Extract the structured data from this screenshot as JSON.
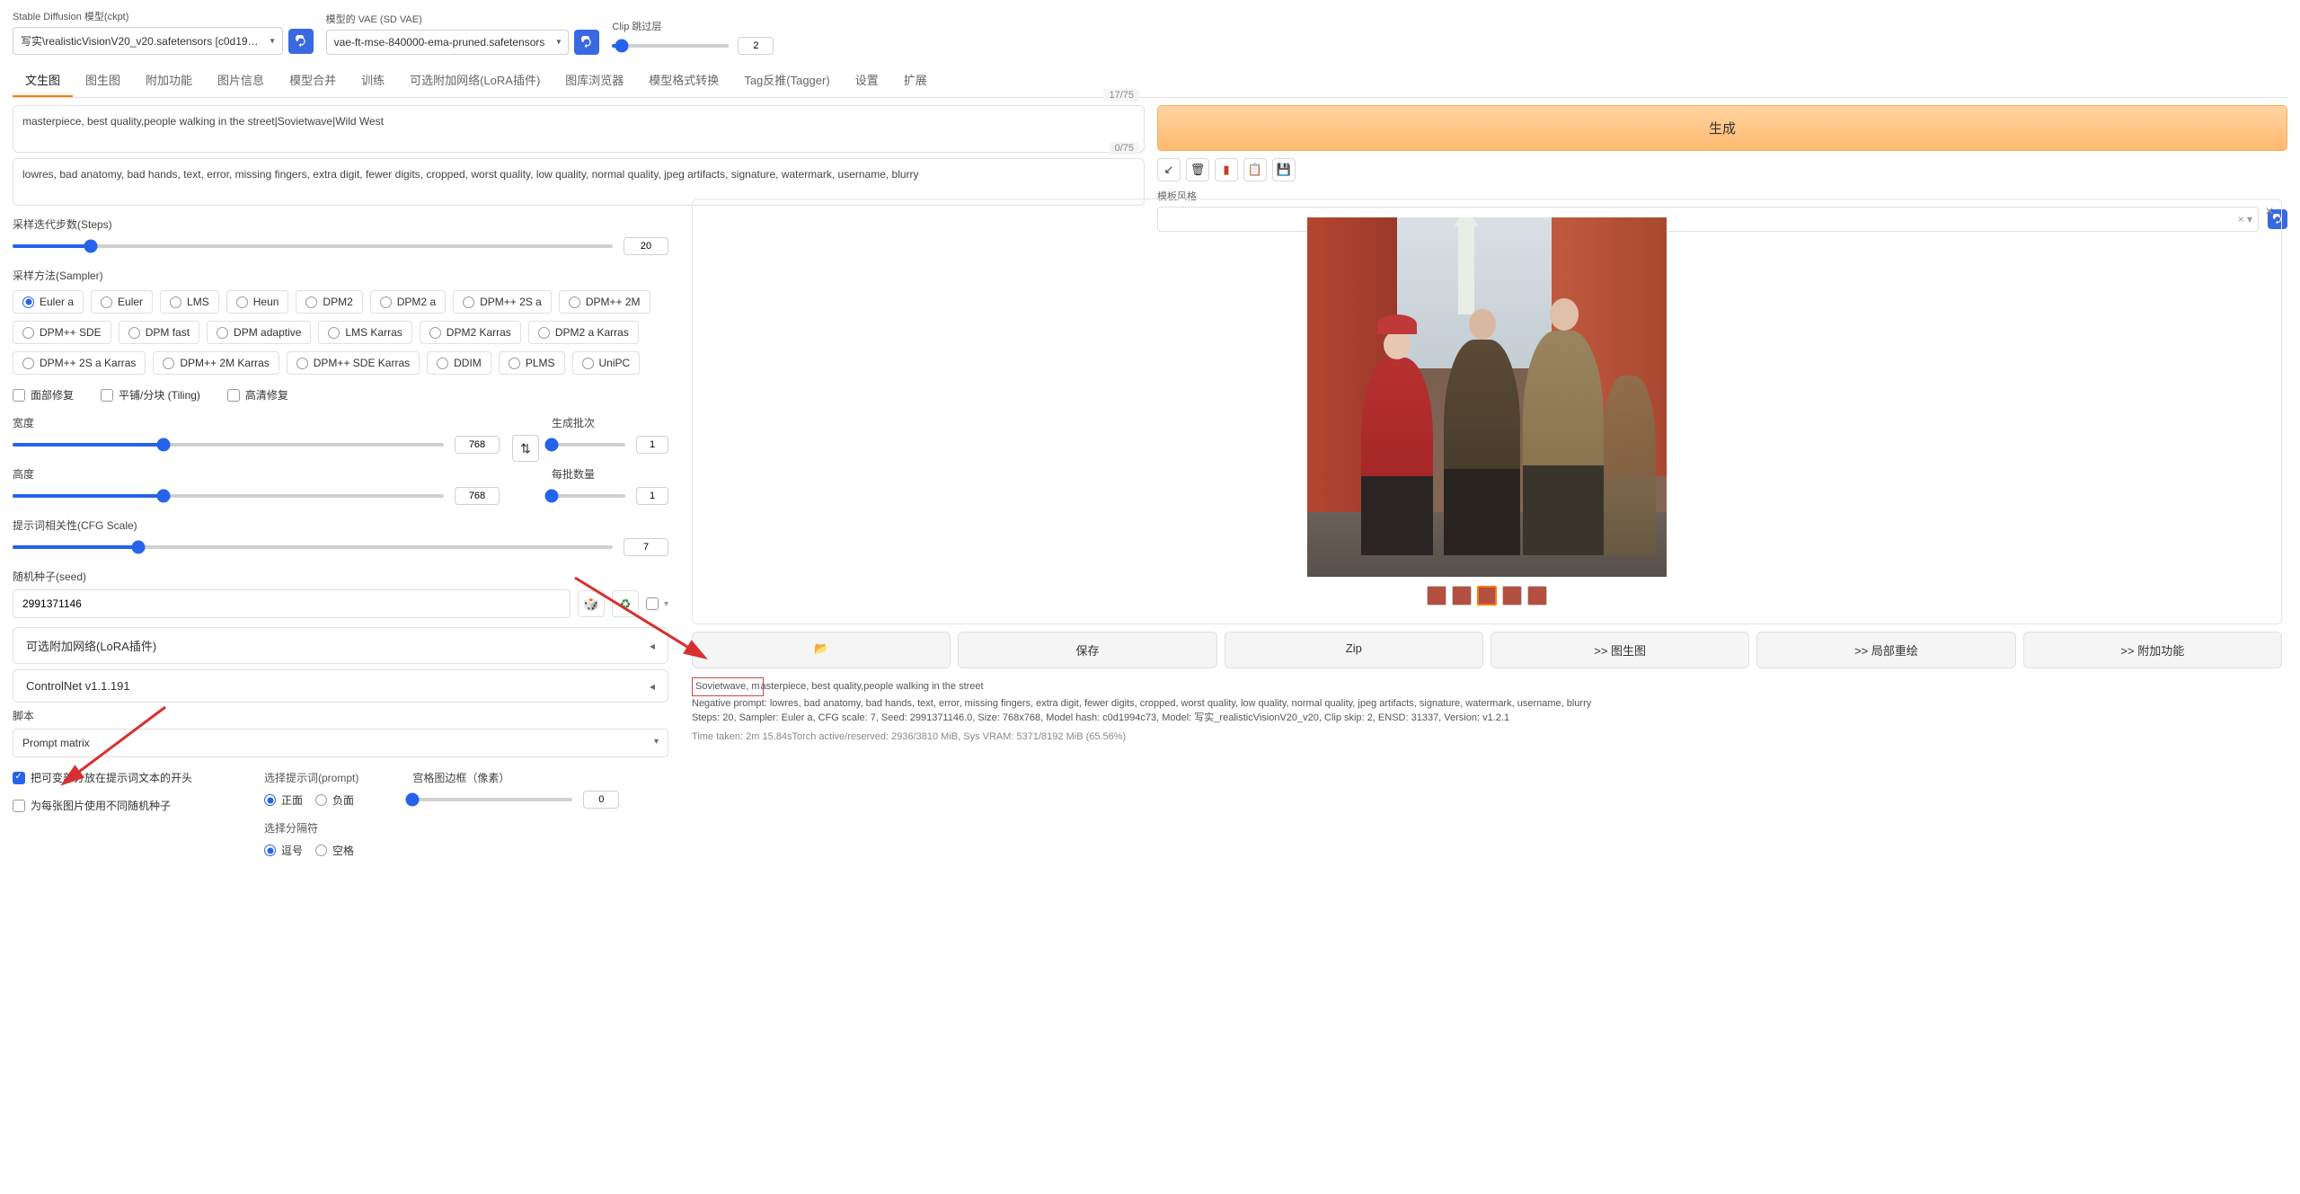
{
  "top": {
    "ckpt_label": "Stable Diffusion 模型(ckpt)",
    "ckpt_value": "写实\\realisticVisionV20_v20.safetensors [c0d19…",
    "vae_label": "模型的 VAE (SD VAE)",
    "vae_value": "vae-ft-mse-840000-ema-pruned.safetensors",
    "clip_label": "Clip 跳过层",
    "clip_value": "2"
  },
  "tabs": [
    "文生图",
    "图生图",
    "附加功能",
    "图片信息",
    "模型合并",
    "训练",
    "可选附加网络(LoRA插件)",
    "图库浏览器",
    "模型格式转换",
    "Tag反推(Tagger)",
    "设置",
    "扩展"
  ],
  "prompt": {
    "text": "masterpiece, best quality,people walking in the street|Sovietwave|Wild West",
    "count": "17/75",
    "neg": "lowres, bad anatomy, bad hands, text, error, missing fingers, extra digit, fewer digits, cropped, worst quality, low quality, normal quality, jpeg artifacts, signature, watermark, username, blurry",
    "negcount": "0/75"
  },
  "right": {
    "generate": "生成",
    "style_label": "模板风格"
  },
  "settings": {
    "steps_label": "采样迭代步数(Steps)",
    "steps": "20",
    "sampler_label": "采样方法(Sampler)",
    "samplers": [
      "Euler a",
      "Euler",
      "LMS",
      "Heun",
      "DPM2",
      "DPM2 a",
      "DPM++ 2S a",
      "DPM++ 2M",
      "DPM++ SDE",
      "DPM fast",
      "DPM adaptive",
      "LMS Karras",
      "DPM2 Karras",
      "DPM2 a Karras",
      "DPM++ 2S a Karras",
      "DPM++ 2M Karras",
      "DPM++ SDE Karras",
      "DDIM",
      "PLMS",
      "UniPC"
    ],
    "face_restore": "面部修复",
    "tiling": "平铺/分块 (Tiling)",
    "hires": "高清修复",
    "width_label": "宽度",
    "width": "768",
    "height_label": "高度",
    "height": "768",
    "batch_count_label": "生成批次",
    "batch_count": "1",
    "batch_size_label": "每批数量",
    "batch_size": "1",
    "cfg_label": "提示词相关性(CFG Scale)",
    "cfg": "7",
    "seed_label": "随机种子(seed)",
    "seed": "2991371146",
    "lora_acc": "可选附加网络(LoRA插件)",
    "cnet_acc": "ControlNet v1.1.191",
    "script_label": "脚本",
    "script": "Prompt matrix"
  },
  "pm": {
    "chk1": "把可变部分放在提示词文本的开头",
    "chk2": "为每张图片使用不同随机种子",
    "sel_prompt": "选择提示词(prompt)",
    "pos": "正面",
    "neg_r": "负面",
    "sel_delim": "选择分隔符",
    "comma": "逗号",
    "space": "空格",
    "margin_label": "宫格图边框（像素）",
    "margin": "0"
  },
  "actions": {
    "folder": "📂",
    "save": "保存",
    "zip": "Zip",
    "to_img2img": ">> 图生图",
    "to_inpaint": ">> 局部重绘",
    "to_extras": ">> 附加功能"
  },
  "info": {
    "l1a": "Sovietwave, m",
    "l1b": "asterpiece, best quality,people walking in the street",
    "l2": "Negative prompt: lowres, bad anatomy, bad hands, text, error, missing fingers, extra digit, fewer digits, cropped, worst quality, low quality, normal quality, jpeg artifacts, signature, watermark, username, blurry",
    "l3": "Steps: 20, Sampler: Euler a, CFG scale: 7, Seed: 2991371146.0, Size: 768x768, Model hash: c0d1994c73, Model: 写实_realisticVisionV20_v20, Clip skip: 2, ENSD: 31337, Version: v1.2.1",
    "l4": "Time taken: 2m 15.84sTorch active/reserved: 2936/3810 MiB, Sys VRAM: 5371/8192 MiB (65.56%)"
  }
}
